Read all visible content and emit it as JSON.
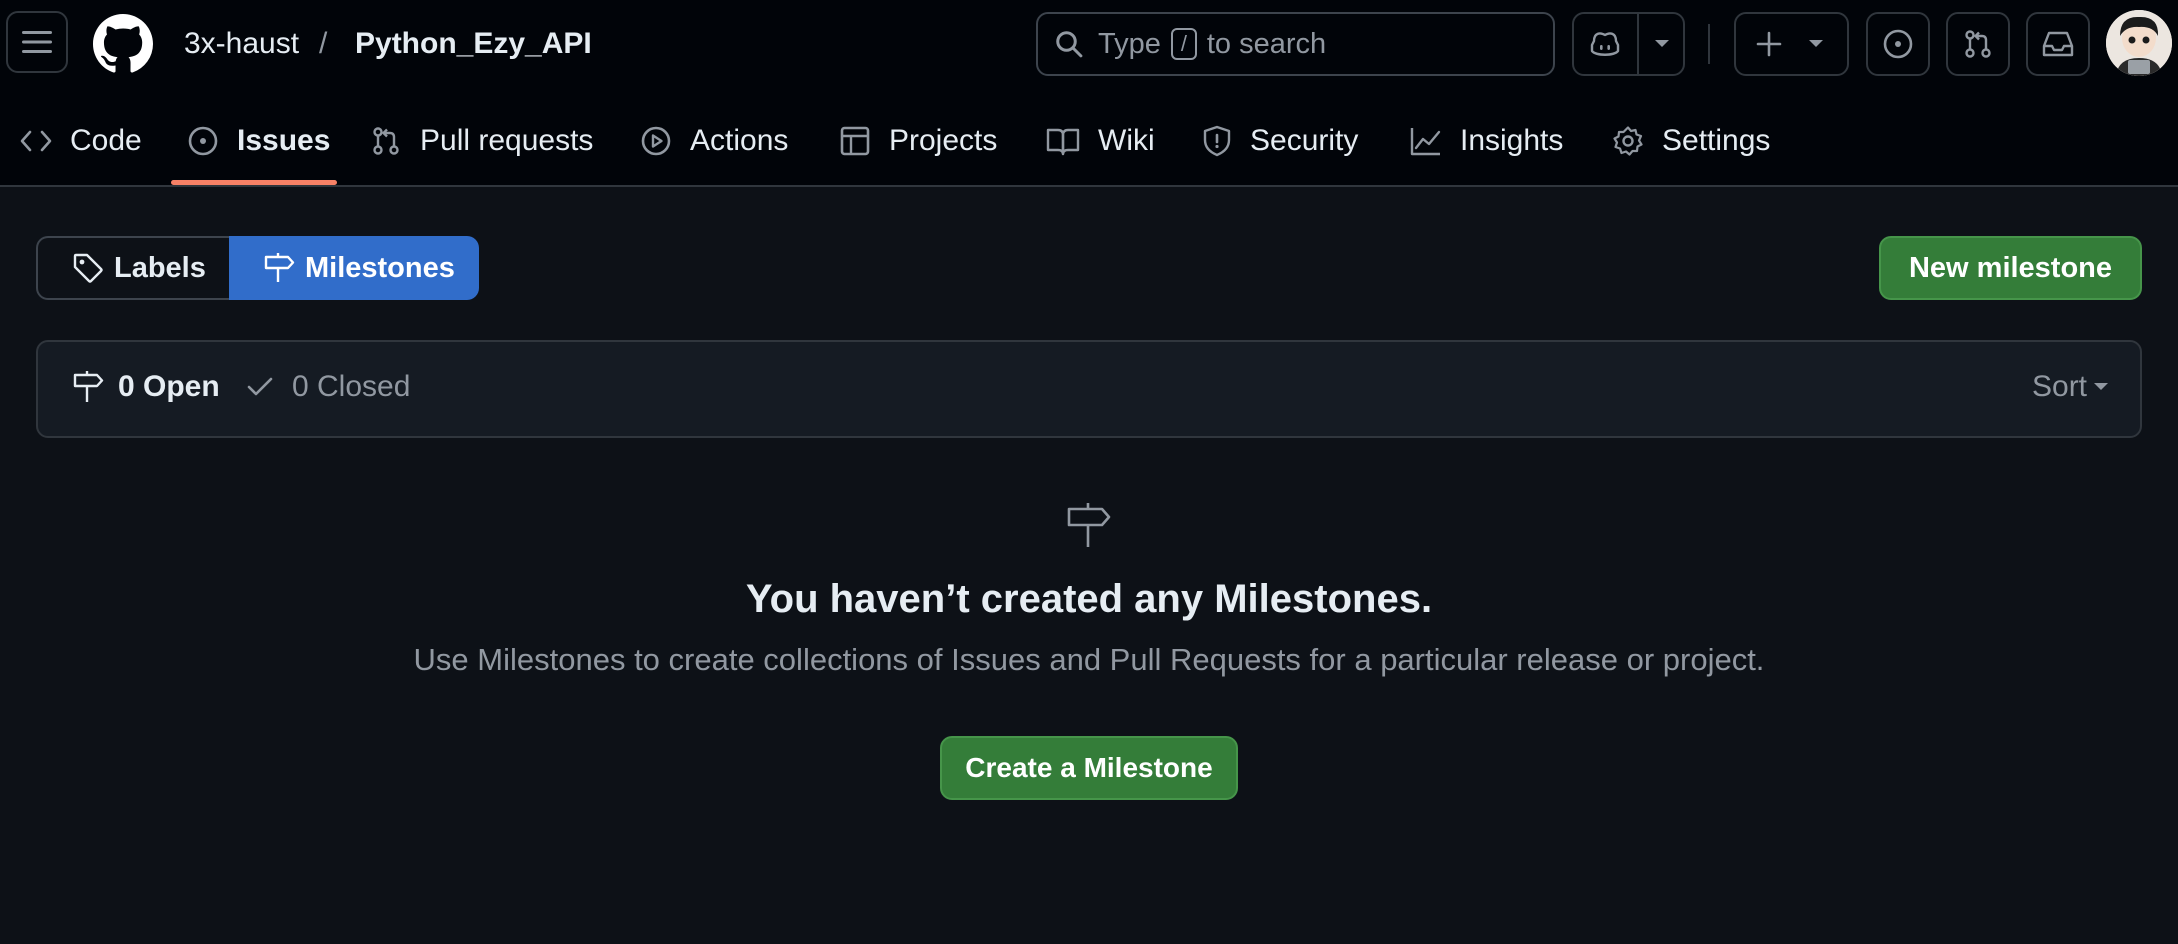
{
  "header": {
    "menu_icon": "hamburger-icon",
    "logo_icon": "github-mark-icon",
    "owner": "3x-haust",
    "separator": "/",
    "repo": "Python_Ezy_API",
    "search": {
      "prefix": "Type",
      "key": "/",
      "suffix": "to search"
    },
    "icons": [
      "copilot-icon",
      "chevron-down-icon",
      "plus-icon",
      "issue-icon",
      "pull-request-icon",
      "inbox-icon",
      "avatar"
    ]
  },
  "repo_nav": {
    "tabs": [
      {
        "label": "Code",
        "icon": "code-icon"
      },
      {
        "label": "Issues",
        "icon": "issue-opened-icon",
        "active": true
      },
      {
        "label": "Pull requests",
        "icon": "git-pull-request-icon"
      },
      {
        "label": "Actions",
        "icon": "play-icon"
      },
      {
        "label": "Projects",
        "icon": "table-icon"
      },
      {
        "label": "Wiki",
        "icon": "book-icon"
      },
      {
        "label": "Security",
        "icon": "shield-icon"
      },
      {
        "label": "Insights",
        "icon": "graph-icon"
      },
      {
        "label": "Settings",
        "icon": "gear-icon"
      }
    ]
  },
  "subnav": {
    "labels": "Labels",
    "milestones": "Milestones"
  },
  "new_milestone": "New milestone",
  "milestones_box": {
    "open": "0 Open",
    "closed": "0 Closed",
    "sort": "Sort"
  },
  "blankslate": {
    "icon": "milestone-icon",
    "title": "You haven’t created any Milestones.",
    "description": "Use Milestones to create collections of Issues and Pull Requests for a particular release or project.",
    "button": "Create a Milestone"
  },
  "colors": {
    "background": "#0d1117",
    "header_bg": "#010409",
    "accent_blue": "#316dca",
    "button_green": "#347d39",
    "tab_underline": "#f78166"
  }
}
